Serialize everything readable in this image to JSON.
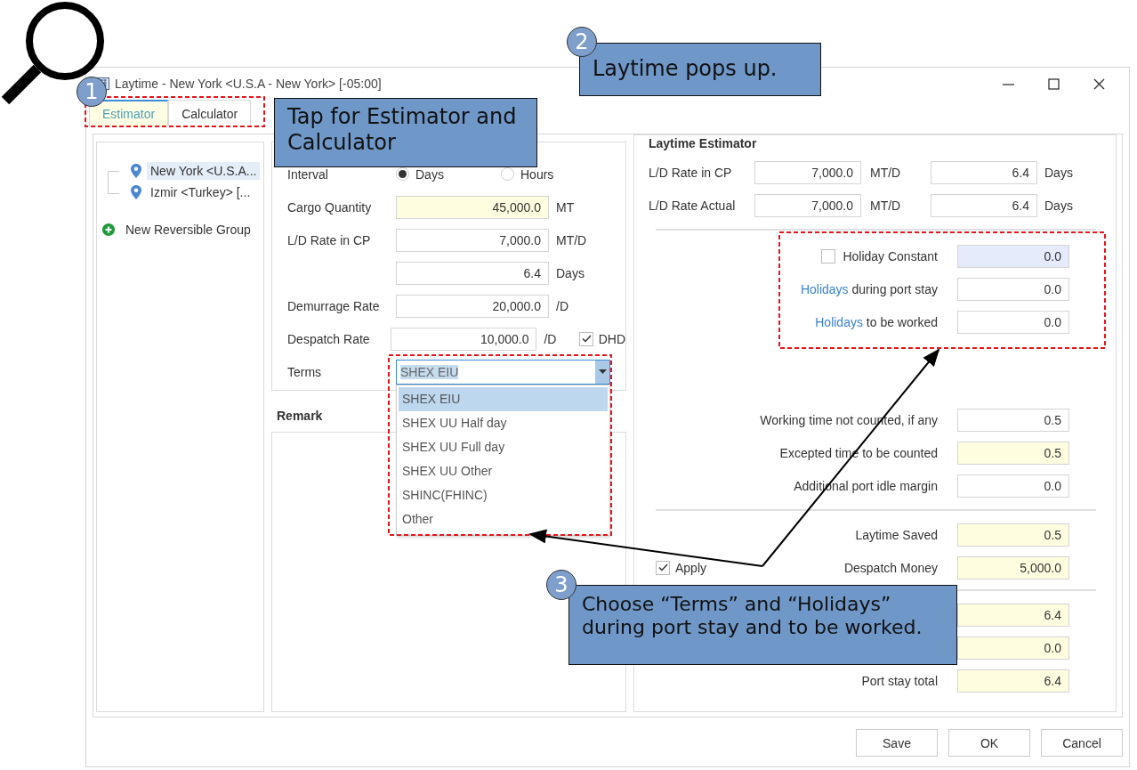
{
  "window": {
    "title": "Laytime - New York <U.S.A - New York> [-05:00]"
  },
  "tabs": [
    {
      "label": "Estimator",
      "selected": true
    },
    {
      "label": "Calculator",
      "selected": false
    }
  ],
  "tree": [
    {
      "label": "New York <U.S.A...",
      "selected": true
    },
    {
      "label": "Izmir <Turkey> [...",
      "selected": false
    }
  ],
  "new_group": "New Reversible Group",
  "interval": {
    "label": "Interval",
    "options": [
      {
        "label": "Days",
        "selected": true
      },
      {
        "label": "Hours",
        "selected": false
      }
    ]
  },
  "fields": [
    {
      "label": "Cargo Quantity",
      "value": "45,000.0",
      "unit": "MT",
      "highlighted": true
    },
    {
      "label": "L/D Rate in CP",
      "value": "7,000.0",
      "unit": "MT/D",
      "highlighted": false
    },
    {
      "value": "6.4",
      "unit": "Days",
      "highlighted": false
    },
    {
      "label": "Demurrage Rate",
      "value": "20,000.0",
      "unit": "/D",
      "highlighted": false
    },
    {
      "label": "Despatch Rate",
      "value": "10,000.0",
      "unit": "/D",
      "highlighted": false,
      "checkbox": {
        "label": "DHD",
        "checked": true
      }
    }
  ],
  "terms": {
    "label": "Terms",
    "value": "SHEX EIU",
    "options": [
      {
        "label": "SHEX EIU",
        "selected": true
      },
      {
        "label": "SHEX UU Half day",
        "selected": false
      },
      {
        "label": "SHEX UU Full day",
        "selected": false
      },
      {
        "label": "SHEX UU Other",
        "selected": false
      },
      {
        "label": "SHINC(FHINC)",
        "selected": false
      },
      {
        "label": "Other",
        "selected": false
      }
    ]
  },
  "remark": {
    "title": "Remark"
  },
  "estimator": {
    "title": "Laytime Estimator",
    "rates": [
      {
        "label": "L/D Rate in CP",
        "value": "7,000.0",
        "unit": "MT/D",
        "days": "6.4",
        "days_unit": "Days"
      },
      {
        "label": "L/D Rate Actual",
        "value": "7,000.0",
        "unit": "MT/D",
        "days": "6.4",
        "days_unit": "Days"
      }
    ],
    "holidays": [
      {
        "kind": "checkbox",
        "label": "Holiday Constant",
        "checked": false,
        "value": "0.0",
        "disabled": true
      },
      {
        "kind": "link",
        "link": "Holidays",
        "label": " during port stay",
        "value": "0.0",
        "disabled": false
      },
      {
        "kind": "link",
        "link": "Holidays",
        "label": " to be worked",
        "value": "0.0",
        "disabled": false
      }
    ],
    "times": [
      {
        "label": "Working time not counted, if any",
        "value": "0.5",
        "highlighted": false
      },
      {
        "label": "Excepted time to be counted",
        "value": "0.5",
        "highlighted": true
      },
      {
        "label": "Additional port idle margin",
        "value": "0.0",
        "highlighted": false
      }
    ],
    "results": [
      {
        "label": "Laytime Saved",
        "value": "0.5",
        "highlighted": true
      },
      {
        "label": "Despatch Money",
        "value": "5,000.0",
        "highlighted": true,
        "apply": {
          "label": "Apply",
          "checked": true
        }
      }
    ],
    "totals": [
      {
        "value": "6.4",
        "highlighted": true
      },
      {
        "value": "0.0",
        "highlighted": true
      },
      {
        "label": "Port stay total",
        "value": "6.4",
        "highlighted": true
      }
    ]
  },
  "buttons": [
    "Save",
    "OK",
    "Cancel"
  ],
  "markers": [
    {
      "number": "1"
    },
    {
      "number": "2"
    },
    {
      "number": "3"
    }
  ],
  "callouts": [
    {
      "text": "Tap for Estimator and Calculator"
    },
    {
      "text": "Laytime pops up."
    },
    {
      "text": "Choose “Terms” and “Holidays” during port stay and to be worked."
    }
  ]
}
